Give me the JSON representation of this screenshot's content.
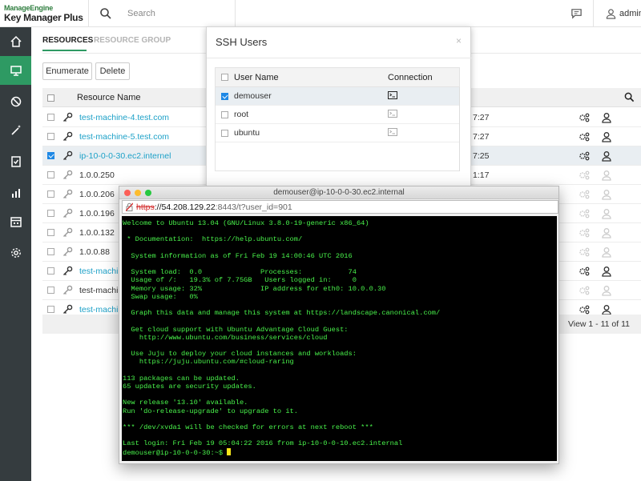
{
  "brand": {
    "line1": "ManageEngine",
    "line2": "Key Manager Plus"
  },
  "header": {
    "search_placeholder": "Search",
    "user": "admin"
  },
  "sidebar": {
    "items": [
      "home",
      "resources",
      "policies",
      "discovery",
      "audit",
      "reports",
      "scheduler",
      "settings"
    ],
    "active": "resources"
  },
  "tabs": {
    "resources": "RESOURCES",
    "resource_group": "RESOURCE GROUP"
  },
  "toolbar": {
    "enumerate": "Enumerate",
    "delete": "Delete"
  },
  "table": {
    "column_resource": "Resource Name",
    "rows": [
      {
        "name": "test-machine-4.test.com",
        "time": "7:27",
        "link": true,
        "selected": false
      },
      {
        "name": "test-machine-5.test.com",
        "time": "7:27",
        "link": true,
        "selected": false
      },
      {
        "name": "ip-10-0-0-30.ec2.internel",
        "time": "7:25",
        "link": true,
        "selected": true
      },
      {
        "name": "1.0.0.250",
        "time": "1:17",
        "link": false,
        "selected": false
      },
      {
        "name": "1.0.0.206",
        "time": "",
        "link": false,
        "selected": false
      },
      {
        "name": "1.0.0.196",
        "time": "",
        "link": false,
        "selected": false
      },
      {
        "name": "1.0.0.132",
        "time": "",
        "link": false,
        "selected": false
      },
      {
        "name": "1.0.0.88",
        "time": "",
        "link": false,
        "selected": false
      },
      {
        "name": "test-machin",
        "time": "",
        "link": true,
        "selected": false
      },
      {
        "name": "test-machin",
        "time": "",
        "link": false,
        "selected": false
      },
      {
        "name": "test-machin",
        "time": "",
        "link": true,
        "selected": false
      }
    ],
    "pager": "View 1 - 11 of 11"
  },
  "modal": {
    "title": "SSH Users",
    "close": "×",
    "col_user": "User Name",
    "col_connection": "Connection",
    "users": [
      {
        "name": "demouser",
        "selected": true
      },
      {
        "name": "root",
        "selected": false
      },
      {
        "name": "ubuntu",
        "selected": false
      }
    ]
  },
  "terminal": {
    "title": "demouser@ip-10-0-0-30.ec2.internal",
    "url_scheme": "https",
    "url_host": "://54.208.129.22",
    "url_rest": ":8443/t?user_id=901",
    "lines": [
      "Welcome to Ubuntu 13.04 (GNU/Linux 3.8.0-19-generic x86_64)",
      "",
      " * Documentation:  https://help.ubuntu.com/",
      "",
      "  System information as of Fri Feb 19 14:00:46 UTC 2016",
      "",
      "  System load:  0.0              Processes:           74",
      "  Usage of /:   19.3% of 7.75GB   Users logged in:     0",
      "  Memory usage: 32%              IP address for eth0: 10.0.0.30",
      "  Swap usage:   0%",
      "",
      "  Graph this data and manage this system at https://landscape.canonical.com/",
      "",
      "  Get cloud support with Ubuntu Advantage Cloud Guest:",
      "    http://www.ubuntu.com/business/services/cloud",
      "",
      "  Use Juju to deploy your cloud instances and workloads:",
      "    https://juju.ubuntu.com/#cloud-raring",
      "",
      "113 packages can be updated.",
      "65 updates are security updates.",
      "",
      "New release '13.10' available.",
      "Run 'do-release-upgrade' to upgrade to it.",
      "",
      "*** /dev/xvda1 will be checked for errors at next reboot ***",
      "",
      "Last login: Fri Feb 19 05:04:22 2016 from ip-10-0-0-10.ec2.internal"
    ],
    "prompt": "demouser@ip-10-0-0-30:~$ "
  }
}
